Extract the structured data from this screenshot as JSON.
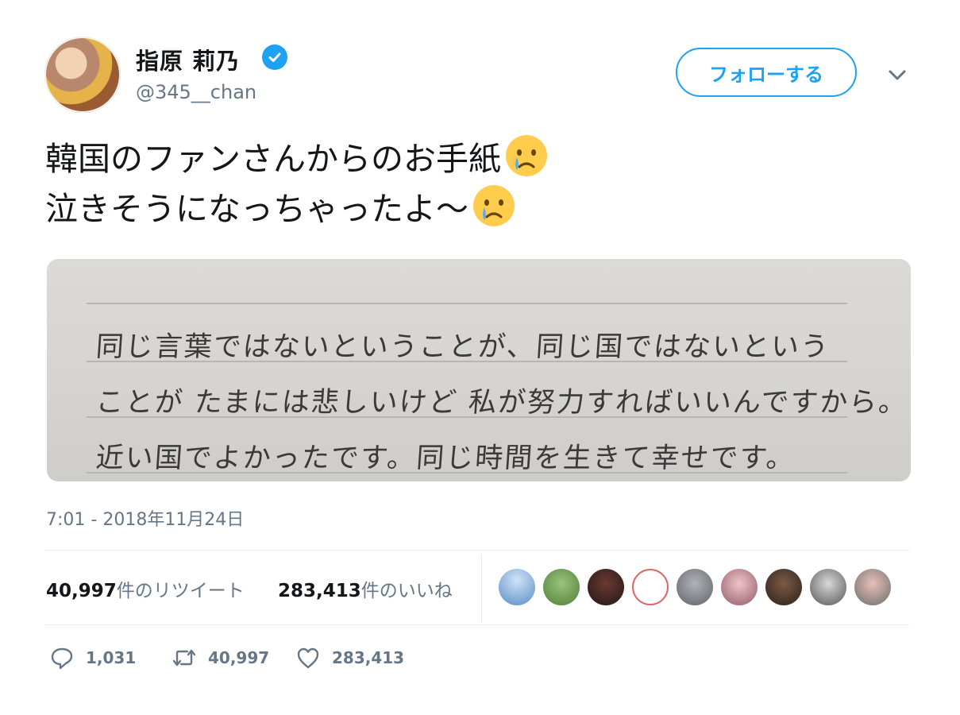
{
  "user": {
    "name": "指原 莉乃",
    "handle": "@345__chan",
    "follow_label": "フォローする"
  },
  "tweet": {
    "line1": "韓国のファンさんからのお手紙",
    "line2": "泣きそうになっちゃったよ〜"
  },
  "image_text": {
    "line1": "同じ言葉ではないということが、同じ国ではないという",
    "line2": "ことが たまには悲しいけど 私が努力すればいいんですから。",
    "line3": "近い国でよかったです。同じ時間を生きて幸せです。"
  },
  "timestamp": "7:01 - 2018年11月24日",
  "stats": {
    "retweets_count": "40,997",
    "retweets_label": "件のリツイート",
    "likes_count": "283,413",
    "likes_label": "件のいいね"
  },
  "actions": {
    "replies": "1,031",
    "retweets": "40,997",
    "likes": "283,413"
  },
  "colors": {
    "accent": "#1da1f2",
    "muted": "#657786"
  },
  "icons": [
    "verified-badge-icon",
    "chevron-down-icon",
    "crying-face-emoji",
    "reply-icon",
    "retweet-icon",
    "like-icon"
  ]
}
